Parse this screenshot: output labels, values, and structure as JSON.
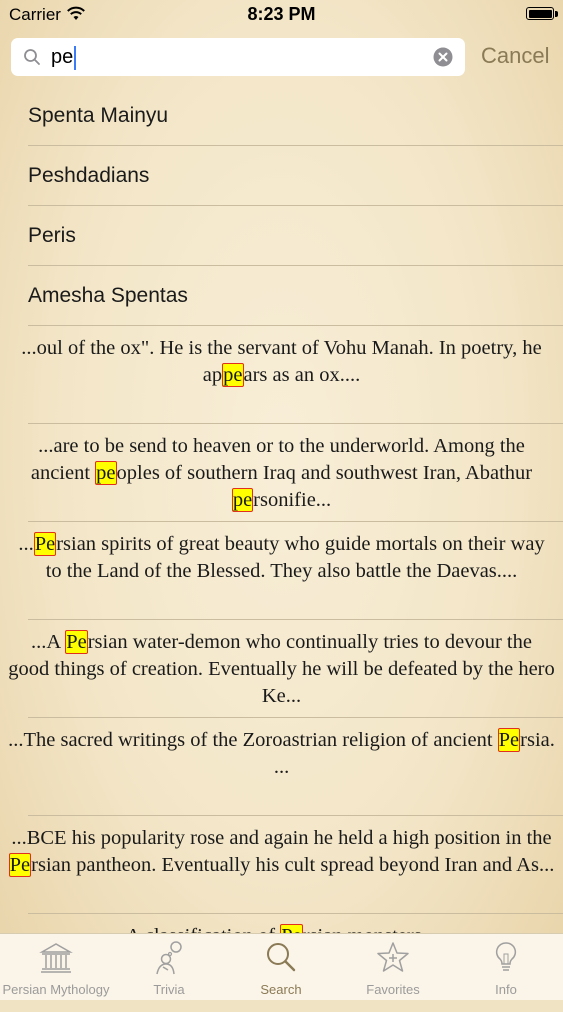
{
  "status_bar": {
    "carrier": "Carrier",
    "time": "8:23 PM"
  },
  "search": {
    "query": "pe",
    "cancel_label": "Cancel"
  },
  "results": {
    "titles": [
      "Spenta Mainyu",
      "Peshdadians",
      "Peris",
      "Amesha Spentas"
    ],
    "snippets": [
      {
        "before": "...oul of the ox\". He is the servant of Vohu Manah. In poetry, he ap",
        "match": "pe",
        "after": "ars as an ox...."
      },
      {
        "before": "...are to be send to heaven or to the underworld. Among the ancient ",
        "match": "pe",
        "after": "oples of southern Iraq and southwest Iran, Abathur ",
        "match2": "pe",
        "after2": "rsonifie..."
      },
      {
        "before": "...",
        "match": "Pe",
        "after": "rsian spirits of great beauty who guide mortals on their way to the Land of the Blessed. They also battle the Daevas...."
      },
      {
        "before": "...A ",
        "match": "Pe",
        "after": "rsian water-demon who continually tries to devour the good things of creation. Eventually he will be defeated by the hero Ke..."
      },
      {
        "before": "...The sacred writings of the Zoroastrian religion of ancient ",
        "match": "Pe",
        "after": "rsia. ..."
      },
      {
        "before": "...BCE his popularity rose and again he held a high position in the ",
        "match": "Pe",
        "after": "rsian pantheon. Eventually his cult spread beyond Iran and As..."
      },
      {
        "before": "A classification of ",
        "match": "Pe",
        "after": "rsian monsters..."
      }
    ]
  },
  "tabbar": {
    "tabs": [
      {
        "label": "Persian Mythology",
        "icon": "temple-icon"
      },
      {
        "label": "Trivia",
        "icon": "thinking-person-icon"
      },
      {
        "label": "Search",
        "icon": "search-icon"
      },
      {
        "label": "Favorites",
        "icon": "star-icon"
      },
      {
        "label": "Info",
        "icon": "lightbulb-icon"
      }
    ],
    "active": "Search"
  }
}
